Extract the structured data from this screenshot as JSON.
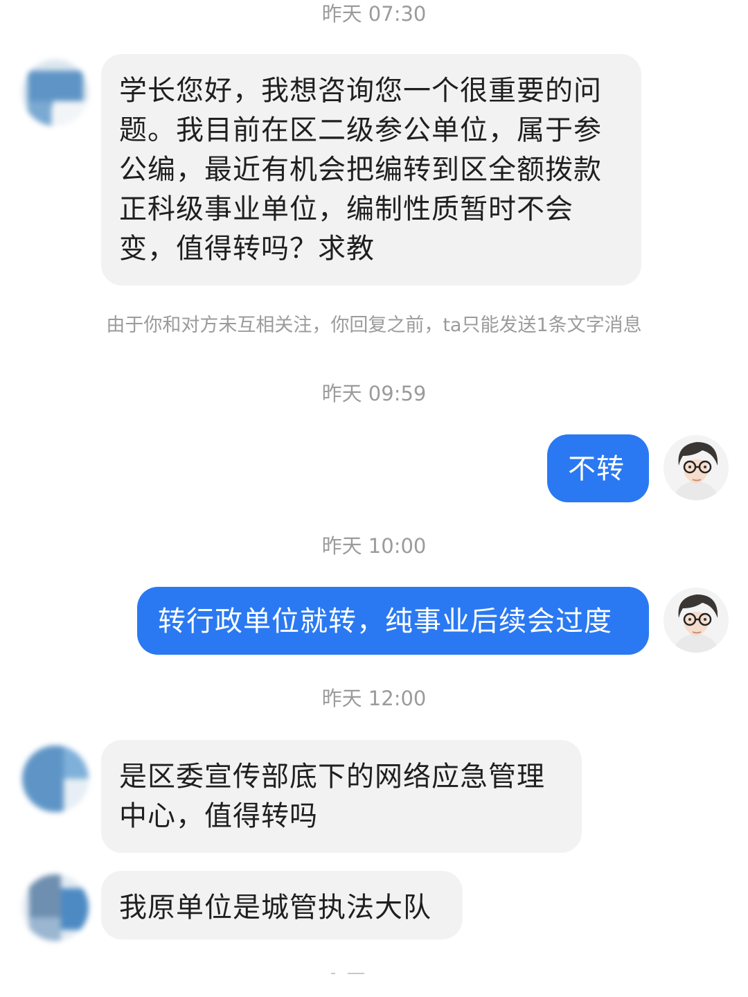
{
  "timestamps": {
    "t1": "昨天 07:30",
    "t2": "昨天 09:59",
    "t3": "昨天 10:00",
    "t4": "昨天 12:00"
  },
  "notice": "由于你和对方未互相关注，你回复之前，ta只能发送1条文字消息",
  "messages": [
    {
      "direction": "incoming",
      "text": "学长您好，我想咨询您一个很重要的问题。我目前在区二级参公单位，属于参公编，最近有机会把编转到区全额拨款正科级事业单位，编制性质暂时不会变，值得转吗？求教"
    },
    {
      "direction": "outgoing",
      "text": "不转"
    },
    {
      "direction": "outgoing",
      "text": "转行政单位就转，纯事业后续会过度"
    },
    {
      "direction": "incoming",
      "text": "是区委宣传部底下的网络应急管理中心，值得转吗"
    },
    {
      "direction": "incoming",
      "text": "我原单位是城管执法大队"
    }
  ],
  "colors": {
    "incoming_bubble": "#f2f2f3",
    "outgoing_bubble": "#2a79f2",
    "timestamp_text": "#9b9b9b"
  },
  "icons": {
    "contact_avatar": "blurred-contact-avatar",
    "my_avatar": "illustrated-man-with-glasses-avatar"
  }
}
